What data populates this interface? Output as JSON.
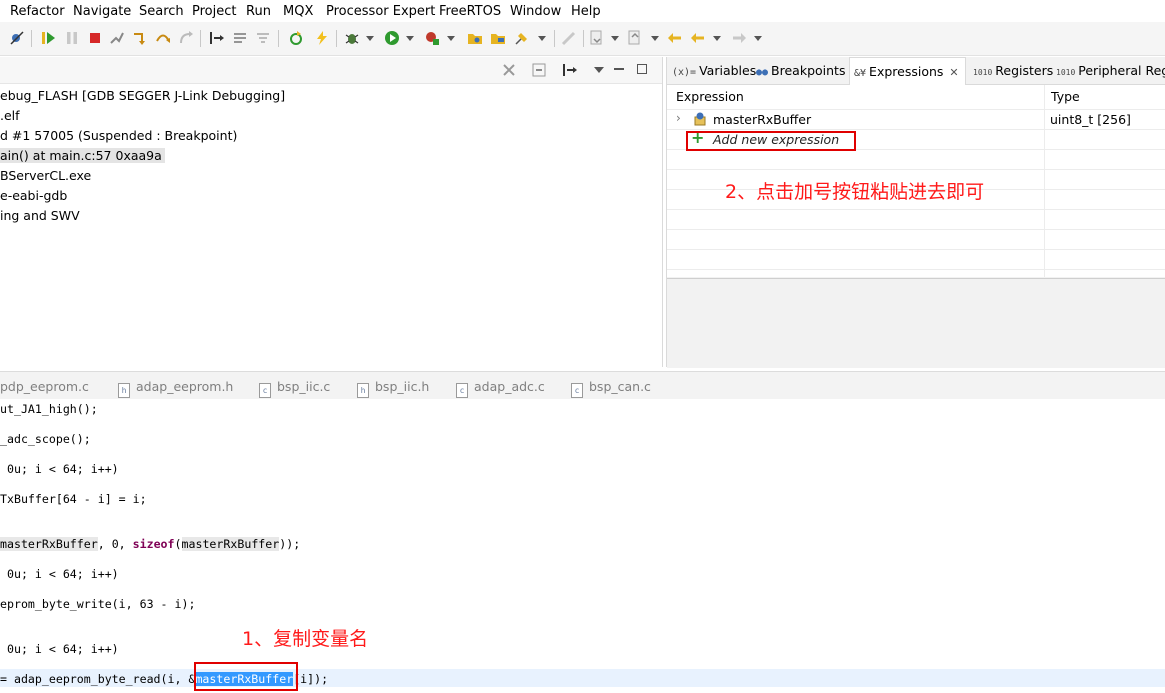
{
  "menu": [
    "Refactor",
    "Navigate",
    "Search",
    "Project",
    "Run",
    "MQX",
    "Processor Expert",
    "FreeRTOS",
    "Window",
    "Help"
  ],
  "toolbar_icons": [
    "skip-breakpoints-icon",
    "resume-icon",
    "suspend-icon",
    "terminate-icon",
    "disconnect-icon",
    "step-into-icon",
    "step-over-icon",
    "step-return-icon",
    "instruction-stepping-icon",
    "drop-to-frame-icon",
    "use-step-filters-icon",
    "restart-icon",
    "lightning-icon",
    "debug-icon",
    "run-icon",
    "external-tools-icon",
    "open-type-icon",
    "open-folder-icon",
    "pin-icon",
    "pen-icon",
    "next-annotation-icon",
    "prev-annotation-icon",
    "back-icon",
    "forward-icon"
  ],
  "debug": {
    "lines": [
      "ebug_FLASH [GDB SEGGER J-Link Debugging]",
      ".elf",
      "d #1 57005 (Suspended : Breakpoint)",
      "ain() at main.c:57 0xaa9a",
      "BServerCL.exe",
      "e-eabi-gdb",
      "ing and SWV"
    ]
  },
  "views": {
    "tabs": [
      "Variables",
      "Breakpoints",
      "Expressions",
      "Registers",
      "Peripheral Regis"
    ],
    "tab_icons": [
      "(x)=",
      "●●",
      "&¥",
      "1010",
      "1010"
    ],
    "active_tab": "Expressions",
    "columns": {
      "expression": "Expression",
      "type": "Type"
    },
    "rows": [
      {
        "name": "masterRxBuffer",
        "type": "uint8_t [256]"
      }
    ],
    "add_new": "Add new expression"
  },
  "editor": {
    "tabs": [
      "pdp_eeprom.c",
      "adap_eeprom.h",
      "bsp_iic.c",
      "bsp_iic.h",
      "adap_adc.c",
      "bsp_can.c"
    ],
    "tab_icons": [
      "c",
      "h",
      "c",
      "h",
      "c",
      "c"
    ],
    "code": {
      "l1": "ut_JA1_high();",
      "l2": "_adc_scope();",
      "l3": " 0u; i < 64; i++)",
      "l4": "TxBuffer[64 - i] = i;",
      "l5_ref1": "masterRxBuffer",
      "l5_mid": ", 0, ",
      "l5_kw": "sizeof",
      "l5_open": "(",
      "l5_ref2": "masterRxBuffer",
      "l5_end": "));",
      "l6": " 0u; i < 64; i++)",
      "l7": "eprom_byte_write(i, 63 - i);",
      "l8": " 0u; i < 64; i++)",
      "l9_pre": "= adap_eeprom_byte_read(i, &",
      "l9_sel": "masterRxBuffer",
      "l9_post": "[i]);"
    }
  },
  "annotations": {
    "step1": "1、复制变量名",
    "step2": "2、点击加号按钮粘贴进去即可"
  },
  "colors": {
    "annotation_red": "#e00000",
    "selection_blue": "#3399ff",
    "keyword": "#7f0055"
  }
}
